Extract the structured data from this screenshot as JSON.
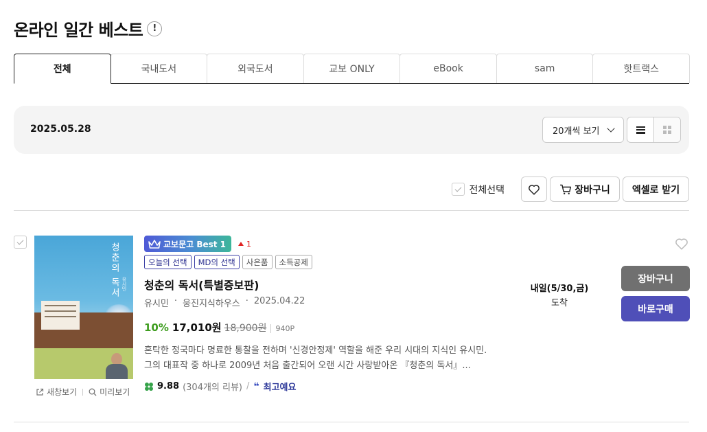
{
  "header": {
    "title": "온라인 일간 베스트",
    "info_icon": "!"
  },
  "tabs": [
    {
      "label": "전체",
      "active": true
    },
    {
      "label": "국내도서"
    },
    {
      "label": "외국도서"
    },
    {
      "label": "교보 ONLY"
    },
    {
      "label": "eBook"
    },
    {
      "label": "sam"
    },
    {
      "label": "핫트랙스"
    }
  ],
  "filter": {
    "date": "2025.05.28",
    "per_page": "20개씩 보기",
    "view_modes": [
      "list-icon",
      "grid-icon"
    ]
  },
  "actions": {
    "select_all": "전체선택",
    "cart": "장바구니",
    "excel": "엑셀로 받기"
  },
  "item": {
    "badge": "교보문고 Best 1",
    "rank_change": "1",
    "tags": [
      "오늘의 선택",
      "MD의 선택",
      "사은품",
      "소득공제"
    ],
    "title": "청춘의 독서(특별증보판)",
    "author": "유시민",
    "publisher": "웅진지식하우스",
    "date": "2025.04.22",
    "discount": "10%",
    "price": "17,010원",
    "original_price": "18,900원",
    "point": "940P",
    "description": "혼탁한 정국마다 명료한 통찰을 전하며 '신경안정제' 역할을 해준 우리 시대의 지식인 유시민. 그의 대표작 중 하나로 2009년 처음 출간되어 오랜 시간 사랑받아온 『청춘의 독서』...",
    "rating": "9.88",
    "review_count": "(304개의 리뷰)",
    "review_keyword": "최고예요",
    "delivery_when": "내일(5/30,금)",
    "delivery_state": "도착",
    "cart_button": "장바구니",
    "buy_button": "바로구매",
    "new_window": "새창보기",
    "preview": "미리보기",
    "cover": {
      "title": "청춘의 독서",
      "author": "유시민"
    }
  },
  "colors": {
    "discount": "#3e9d1f",
    "buy_button": "#4f4fb8",
    "cart_button": "#707070",
    "rank_up": "#e02222",
    "badge_start": "#4f5ad6",
    "badge_end": "#3db69a"
  }
}
